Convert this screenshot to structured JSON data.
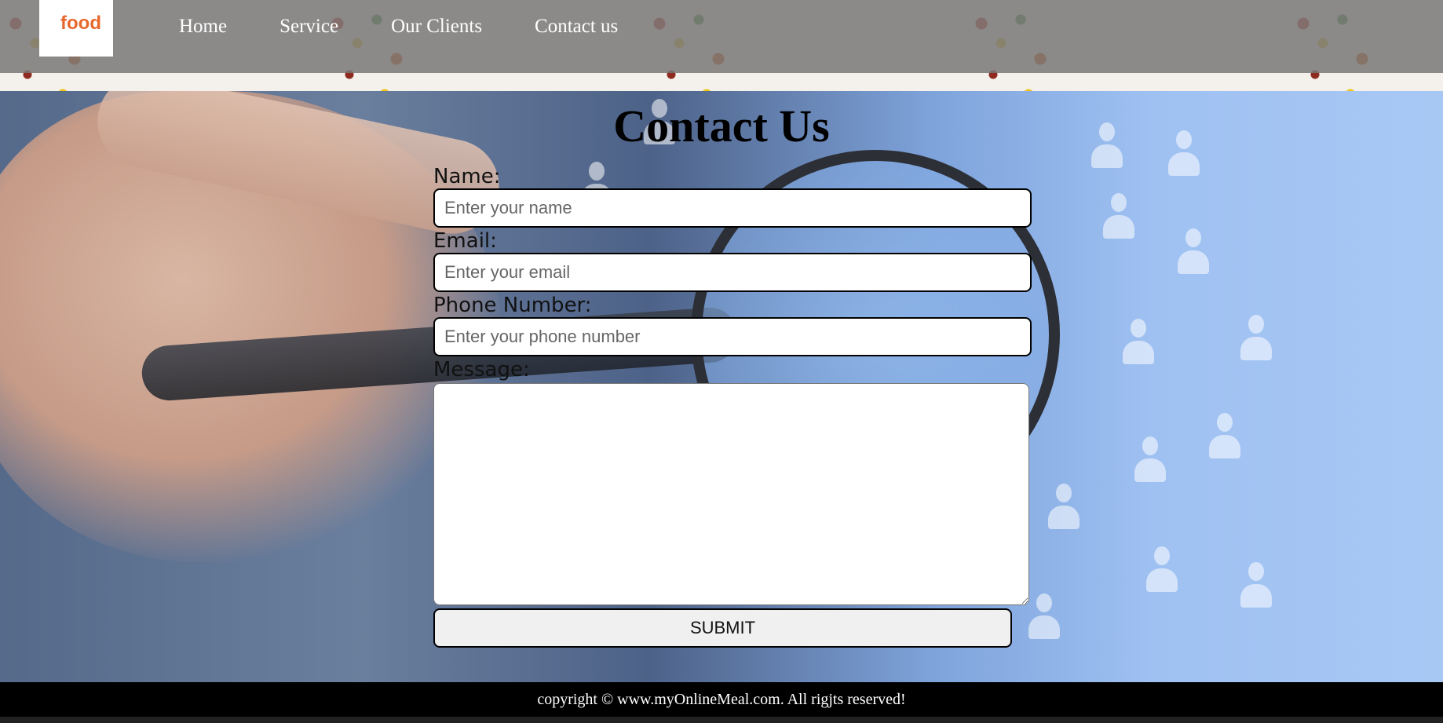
{
  "nav": {
    "logo_text": "food",
    "links": [
      "Home",
      "Service",
      "Our Clients",
      "Contact us"
    ]
  },
  "form": {
    "title": "Contact Us",
    "name_label": "Name:",
    "name_placeholder": "Enter your name",
    "email_label": "Email:",
    "email_placeholder": "Enter your email",
    "phone_label": "Phone Number:",
    "phone_placeholder": "Enter your phone number",
    "message_label": "Message:",
    "submit_label": "SUBMIT"
  },
  "footer": {
    "copyright": "copyright © www.myOnlineMeal.com. All rigjts reserved!"
  },
  "colors": {
    "navbar_bg": "#7a7a7a",
    "logo_accent": "#e8672c",
    "footer_bg": "#000000"
  }
}
